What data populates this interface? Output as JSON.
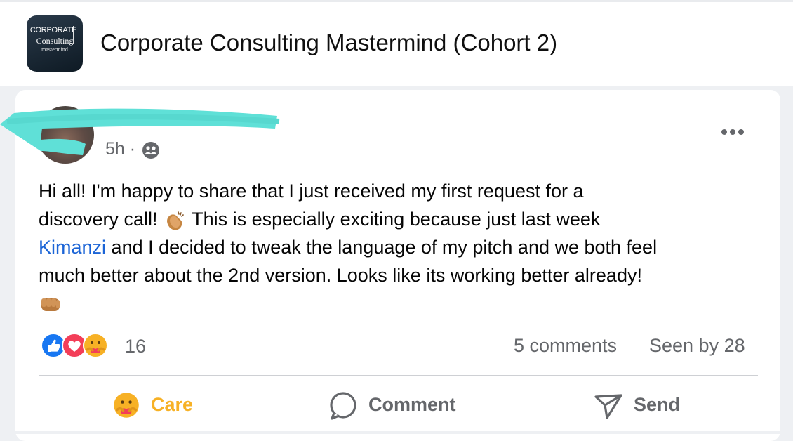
{
  "group": {
    "logo_text": [
      "CORPORATE",
      "Consulting",
      "mastermind"
    ],
    "title": "Corporate Consulting Mastermind (Cohort 2)"
  },
  "post": {
    "time": "5h ·",
    "audience_icon": "group-members-icon",
    "more_icon": "more-options-icon",
    "body": {
      "line1": "Hi all! I'm happy to share that I just received my first request for a",
      "line2_before": "discovery call!",
      "line2_after": "This is especially exciting because just last week",
      "mention": "Kimanzi",
      "line3_after": "and I decided to tweak the language of my pitch and we both feel",
      "line4": "much better about the 2nd version. Looks like its working better already!",
      "emojis": [
        "clapping-hands",
        "oncoming-fist"
      ]
    },
    "reactions": {
      "icons": [
        "like-reaction-icon",
        "love-reaction-icon",
        "care-reaction-icon"
      ],
      "count": "16"
    },
    "comments_count": "5 comments",
    "seen_by": "Seen by 28"
  },
  "actions": {
    "care_label": "Care",
    "comment_label": "Comment",
    "send_label": "Send"
  },
  "colors": {
    "care": "#f7b125",
    "secondary_text": "#65676b",
    "mention": "#1b64d6",
    "like_blue": "#1877f2",
    "love_red": "#f33e58"
  }
}
